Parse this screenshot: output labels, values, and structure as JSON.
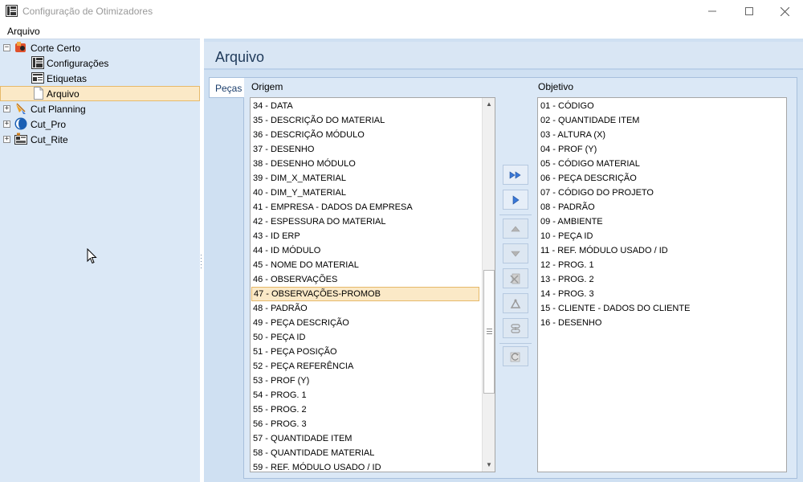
{
  "window": {
    "title": "Configuração de Otimizadores",
    "minimize_icon": "minimize-icon",
    "maximize_icon": "maximize-icon",
    "close_icon": "close-icon"
  },
  "menu": {
    "items": [
      "Arquivo"
    ]
  },
  "tree": {
    "nodes": [
      {
        "label": "Corte Certo",
        "icon": "corte-certo-icon",
        "expander": "−"
      },
      {
        "label": "Configurações",
        "icon": "configuracoes-icon"
      },
      {
        "label": "Etiquetas",
        "icon": "etiquetas-icon"
      },
      {
        "label": "Arquivo",
        "icon": "document-icon",
        "selected": true
      },
      {
        "label": "Cut Planning",
        "icon": "cut-planning-icon",
        "expander": "+"
      },
      {
        "label": "Cut_Pro",
        "icon": "cut-pro-icon",
        "expander": "+"
      },
      {
        "label": "Cut_Rite",
        "icon": "cut-rite-icon",
        "expander": "+"
      }
    ]
  },
  "panel": {
    "title": "Arquivo",
    "tab_label": "Peças",
    "origem_label": "Origem",
    "objetivo_label": "Objetivo"
  },
  "origem_items": [
    "34 - DATA",
    "35 - DESCRIÇÃO DO MATERIAL",
    "36 - DESCRIÇÃO MÓDULO",
    "37 - DESENHO",
    "38 - DESENHO MÓDULO",
    "39 - DIM_X_MATERIAL",
    "40 - DIM_Y_MATERIAL",
    "41 - EMPRESA - DADOS DA EMPRESA",
    "42 - ESPESSURA DO MATERIAL",
    "43 - ID ERP",
    "44 - ID MÓDULO",
    "45 - NOME DO MATERIAL",
    "46 - OBSERVAÇÕES",
    "47 - OBSERVAÇÕES-PROMOB",
    "48 - PADRÃO",
    "49 - PEÇA DESCRIÇÃO",
    "50 - PEÇA ID",
    "51 - PEÇA POSIÇÃO",
    "52 - PEÇA REFERÊNCIA",
    "53 - PROF (Y)",
    "54 - PROG. 1",
    "55 - PROG. 2",
    "56 - PROG. 3",
    "57 - QUANTIDADE ITEM",
    "58 - QUANTIDADE MATERIAL",
    "59 - REF. MÓDULO USADO / ID"
  ],
  "origem_selected": "47 - OBSERVAÇÕES-PROMOB",
  "objetivo_items": [
    "01 - CÓDIGO",
    "02 - QUANTIDADE ITEM",
    "03 - ALTURA (X)",
    "04 - PROF (Y)",
    "05 - CÓDIGO MATERIAL",
    "06 - PEÇA DESCRIÇÃO",
    "07 - CÓDIGO DO PROJETO",
    "08 - PADRÃO",
    "09 - AMBIENTE",
    "10 - PEÇA ID",
    "11 - REF. MÓDULO USADO / ID",
    "12 - PROG. 1",
    "13 - PROG. 2",
    "14 - PROG. 3",
    "15 - CLIENTE - DADOS DO CLIENTE",
    "16 - DESENHO"
  ],
  "buttons": [
    {
      "name": "add-all-button",
      "icon": "double-arrow-right-icon"
    },
    {
      "name": "add-button",
      "icon": "arrow-right-icon"
    },
    {
      "name": "move-up-button",
      "icon": "arrow-up-icon"
    },
    {
      "name": "move-down-button",
      "icon": "arrow-down-icon"
    },
    {
      "name": "remove-button",
      "icon": "delete-icon"
    },
    {
      "name": "edit-button",
      "icon": "edit-icon"
    },
    {
      "name": "link-button",
      "icon": "link-icon"
    },
    {
      "name": "refresh-button",
      "icon": "refresh-icon"
    }
  ],
  "colors": {
    "tree_bg": "#dbe8f6",
    "panel_bg": "#cfe0f2",
    "selection_bg": "#fbe9c7",
    "selection_border": "#e6b96a",
    "button_arrow": "#3a78d8"
  }
}
